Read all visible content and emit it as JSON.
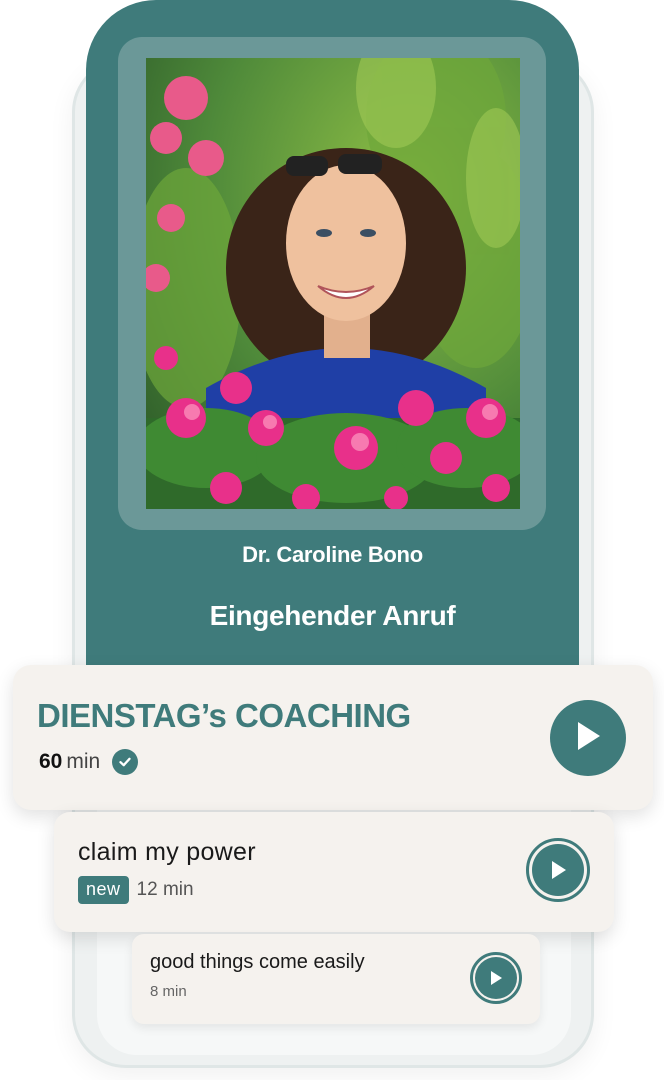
{
  "call": {
    "caller_name": "Dr. Caroline Bono",
    "status": "Eingehender Anruf"
  },
  "sessions": {
    "featured": {
      "title": "DIENSTAG’s COACHING",
      "duration_value": "60",
      "duration_unit": "min"
    },
    "items": [
      {
        "title": "claim my power",
        "badge": "new",
        "duration": "12 min"
      },
      {
        "title": "good things come easily",
        "duration": "8 min"
      }
    ]
  },
  "colors": {
    "accent": "#3f7b7b",
    "card_background": "#f5f2ee",
    "photo_frame": "#6b9898"
  },
  "icons": {
    "play": "play-icon",
    "check": "check-icon"
  }
}
